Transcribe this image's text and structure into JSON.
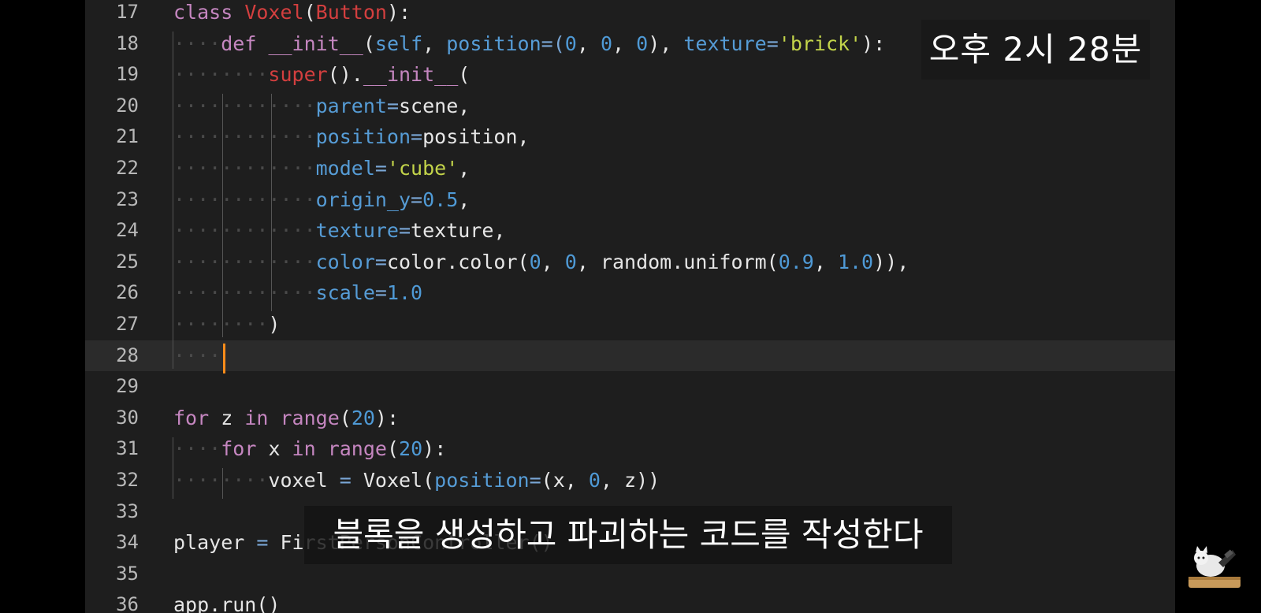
{
  "editor": {
    "cursor_line": 28,
    "lines": [
      {
        "n": "17",
        "tokens": [
          {
            "t": "class ",
            "c": "kw"
          },
          {
            "t": "Voxel",
            "c": "cls"
          },
          {
            "t": "(",
            "c": ""
          },
          {
            "t": "Button",
            "c": "cls"
          },
          {
            "t": "):",
            "c": ""
          }
        ]
      },
      {
        "n": "18",
        "tokens": [
          {
            "t": "····",
            "c": "ind"
          },
          {
            "t": "def ",
            "c": "kw"
          },
          {
            "t": "__init__",
            "c": "fnc"
          },
          {
            "t": "(",
            "c": ""
          },
          {
            "t": "self",
            "c": "param"
          },
          {
            "t": ", ",
            "c": ""
          },
          {
            "t": "position",
            "c": "param"
          },
          {
            "t": "=(",
            "c": "op"
          },
          {
            "t": "0",
            "c": "num"
          },
          {
            "t": ", ",
            "c": ""
          },
          {
            "t": "0",
            "c": "num"
          },
          {
            "t": ", ",
            "c": ""
          },
          {
            "t": "0",
            "c": "num"
          },
          {
            "t": "), ",
            "c": ""
          },
          {
            "t": "texture",
            "c": "param"
          },
          {
            "t": "=",
            "c": "op"
          },
          {
            "t": "'brick'",
            "c": "str"
          },
          {
            "t": "):",
            "c": ""
          }
        ]
      },
      {
        "n": "19",
        "tokens": [
          {
            "t": "········",
            "c": "ind"
          },
          {
            "t": "super",
            "c": "cls"
          },
          {
            "t": "().",
            "c": ""
          },
          {
            "t": "__init__",
            "c": "fnc"
          },
          {
            "t": "(",
            "c": ""
          }
        ]
      },
      {
        "n": "20",
        "tokens": [
          {
            "t": "············",
            "c": "ind"
          },
          {
            "t": "parent",
            "c": "param"
          },
          {
            "t": "=",
            "c": "op"
          },
          {
            "t": "scene,",
            "c": ""
          }
        ]
      },
      {
        "n": "21",
        "tokens": [
          {
            "t": "············",
            "c": "ind"
          },
          {
            "t": "position",
            "c": "param"
          },
          {
            "t": "=",
            "c": "op"
          },
          {
            "t": "position,",
            "c": ""
          }
        ]
      },
      {
        "n": "22",
        "tokens": [
          {
            "t": "············",
            "c": "ind"
          },
          {
            "t": "model",
            "c": "param"
          },
          {
            "t": "=",
            "c": "op"
          },
          {
            "t": "'cube'",
            "c": "str"
          },
          {
            "t": ",",
            "c": ""
          }
        ]
      },
      {
        "n": "23",
        "tokens": [
          {
            "t": "············",
            "c": "ind"
          },
          {
            "t": "origin_y",
            "c": "param"
          },
          {
            "t": "=",
            "c": "op"
          },
          {
            "t": "0.5",
            "c": "num"
          },
          {
            "t": ",",
            "c": ""
          }
        ]
      },
      {
        "n": "24",
        "tokens": [
          {
            "t": "············",
            "c": "ind"
          },
          {
            "t": "texture",
            "c": "param"
          },
          {
            "t": "=",
            "c": "op"
          },
          {
            "t": "texture,",
            "c": ""
          }
        ]
      },
      {
        "n": "25",
        "tokens": [
          {
            "t": "············",
            "c": "ind"
          },
          {
            "t": "color",
            "c": "param"
          },
          {
            "t": "=",
            "c": "op"
          },
          {
            "t": "color.color(",
            "c": ""
          },
          {
            "t": "0",
            "c": "num"
          },
          {
            "t": ", ",
            "c": ""
          },
          {
            "t": "0",
            "c": "num"
          },
          {
            "t": ", random.uniform(",
            "c": ""
          },
          {
            "t": "0.9",
            "c": "num"
          },
          {
            "t": ", ",
            "c": ""
          },
          {
            "t": "1.0",
            "c": "num"
          },
          {
            "t": ")),",
            "c": ""
          }
        ]
      },
      {
        "n": "26",
        "tokens": [
          {
            "t": "············",
            "c": "ind"
          },
          {
            "t": "scale",
            "c": "param"
          },
          {
            "t": "=",
            "c": "op"
          },
          {
            "t": "1.0",
            "c": "num"
          }
        ]
      },
      {
        "n": "27",
        "tokens": [
          {
            "t": "········",
            "c": "ind"
          },
          {
            "t": ")",
            "c": ""
          }
        ]
      },
      {
        "n": "28",
        "tokens": [
          {
            "t": "····",
            "c": "ind"
          }
        ]
      },
      {
        "n": "29",
        "tokens": []
      },
      {
        "n": "30",
        "tokens": [
          {
            "t": "for ",
            "c": "kw"
          },
          {
            "t": "z ",
            "c": ""
          },
          {
            "t": "in ",
            "c": "kw"
          },
          {
            "t": "range",
            "c": "fnc"
          },
          {
            "t": "(",
            "c": ""
          },
          {
            "t": "20",
            "c": "num"
          },
          {
            "t": "):",
            "c": ""
          }
        ]
      },
      {
        "n": "31",
        "tokens": [
          {
            "t": "····",
            "c": "ind"
          },
          {
            "t": "for ",
            "c": "kw"
          },
          {
            "t": "x ",
            "c": ""
          },
          {
            "t": "in ",
            "c": "kw"
          },
          {
            "t": "range",
            "c": "fnc"
          },
          {
            "t": "(",
            "c": ""
          },
          {
            "t": "20",
            "c": "num"
          },
          {
            "t": "):",
            "c": ""
          }
        ]
      },
      {
        "n": "32",
        "tokens": [
          {
            "t": "········",
            "c": "ind"
          },
          {
            "t": "voxel ",
            "c": ""
          },
          {
            "t": "= ",
            "c": "op"
          },
          {
            "t": "Voxel(",
            "c": ""
          },
          {
            "t": "position",
            "c": "param"
          },
          {
            "t": "=",
            "c": "op"
          },
          {
            "t": "(x, ",
            "c": ""
          },
          {
            "t": "0",
            "c": "num"
          },
          {
            "t": ", z))",
            "c": ""
          }
        ]
      },
      {
        "n": "33",
        "tokens": []
      },
      {
        "n": "34",
        "tokens": [
          {
            "t": "player ",
            "c": ""
          },
          {
            "t": "= ",
            "c": "op"
          },
          {
            "t": "FirstPersonController()",
            "c": ""
          }
        ]
      },
      {
        "n": "35",
        "tokens": []
      },
      {
        "n": "36",
        "tokens": [
          {
            "t": "app.run()",
            "c": ""
          }
        ]
      }
    ]
  },
  "overlay": {
    "timestamp": "오후 2시 28분",
    "subtitle": "블록을 생성하고 파괴하는 코드를 작성한다"
  },
  "colors": {
    "editor_bg": "#1e1e1e",
    "cursor": "#ff8c1a",
    "keyword": "#c586c0",
    "class_name": "#d43f3f",
    "parameter": "#569cd6",
    "string": "#c3d44a"
  },
  "icons": {
    "logo": "cat-mascot-icon"
  }
}
